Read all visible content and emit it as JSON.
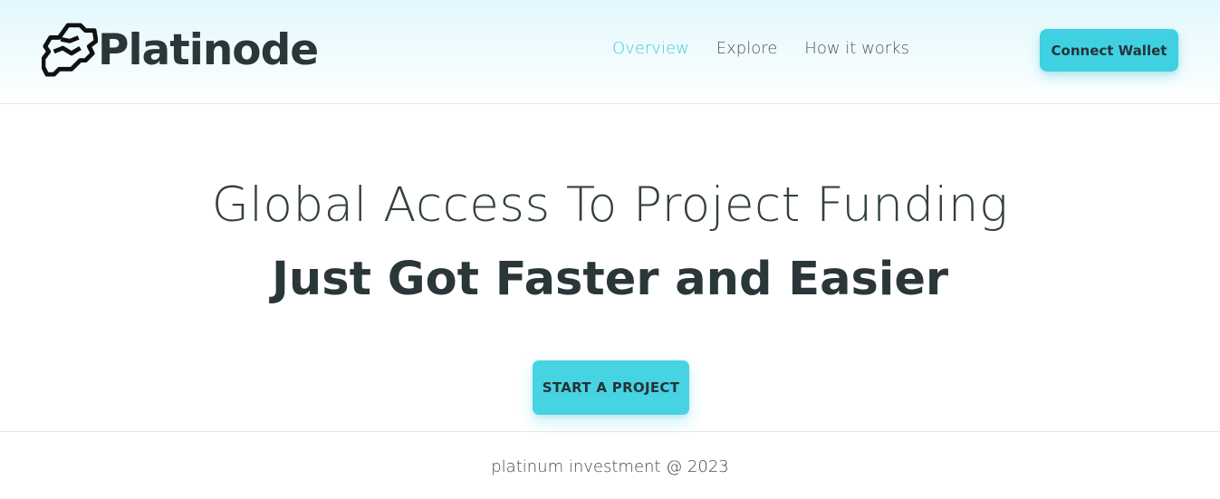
{
  "header": {
    "brand_name": "Platinode",
    "logo_icon": "platinode-logo-icon",
    "nav": [
      {
        "label": "Overview",
        "active": true
      },
      {
        "label": "Explore",
        "active": false
      },
      {
        "label": "How it works",
        "active": false
      }
    ],
    "connect_label": "Connect Wallet"
  },
  "hero": {
    "line1": "Global Access To Project Funding",
    "line2": "Just Got Faster and Easier",
    "cta_label": "START A PROJECT"
  },
  "footer": {
    "text": "platinum investment @ 2023"
  },
  "colors": {
    "accent": "#3fd1e1",
    "nav_active": "#42c9d9",
    "text_dark": "#2b3639",
    "header_bg": "#e3f8fd"
  }
}
